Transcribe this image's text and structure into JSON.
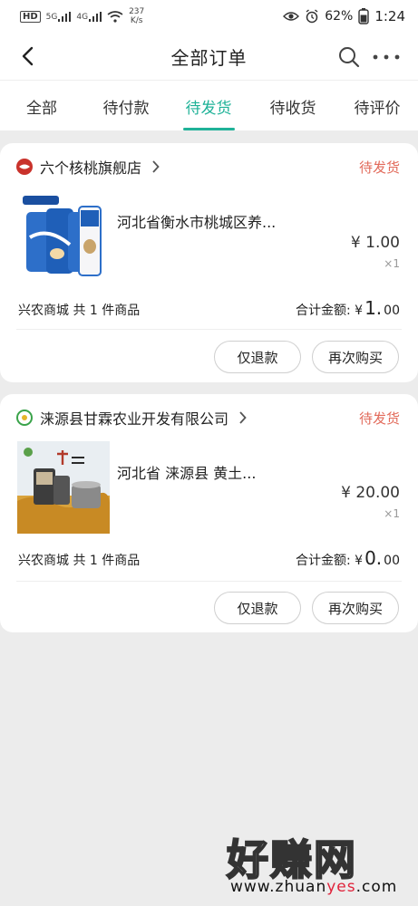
{
  "status_bar": {
    "hd": "HD",
    "signal_1": "5G",
    "signal_2": "4G",
    "net_speed": "237",
    "net_unit": "K/s",
    "battery": "62%",
    "time": "1:24"
  },
  "header": {
    "title": "全部订单"
  },
  "tabs": [
    {
      "label": "全部",
      "active": false
    },
    {
      "label": "待付款",
      "active": false
    },
    {
      "label": "待发货",
      "active": true
    },
    {
      "label": "待收货",
      "active": false
    },
    {
      "label": "待评价",
      "active": false
    }
  ],
  "accent_color": "#1fb298",
  "status_color": "#e26a5a",
  "orders": [
    {
      "store": "六个核桃旗舰店",
      "status": "待发货",
      "product": "河北省衡水市桃城区养...",
      "price": "¥ 1.00",
      "qty": "×1",
      "summary": "兴农商城 共 1 件商品",
      "total_label": "合计金额: ¥",
      "total_int": "1.",
      "total_dec": "00",
      "btn_refund": "仅退款",
      "btn_rebuy": "再次购买"
    },
    {
      "store": "涞源县甘霖农业开发有限公司",
      "status": "待发货",
      "product": "河北省 涞源县 黄土...",
      "price": "¥ 20.00",
      "qty": "×1",
      "summary": "兴农商城 共 1 件商品",
      "total_label": "合计金额: ¥",
      "total_int": "0.",
      "total_dec": "00",
      "btn_refund": "仅退款",
      "btn_rebuy": "再次购买"
    }
  ],
  "watermark": {
    "text": "好赚网",
    "url_a": "www.zhuan",
    "url_b": "yes",
    "url_c": ".com"
  }
}
